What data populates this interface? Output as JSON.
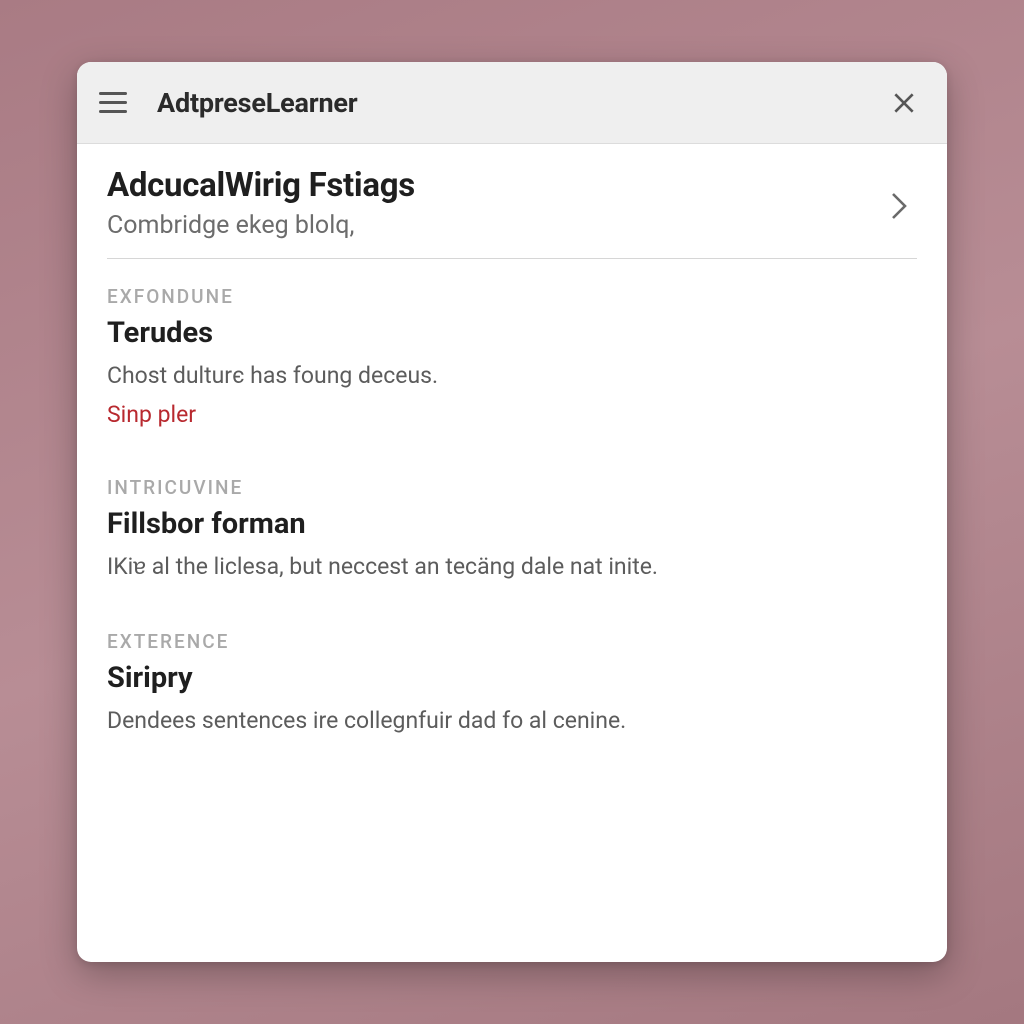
{
  "app": {
    "title": "AdtpreseLearner"
  },
  "hero": {
    "title": "AdcucalWirig Fstiags",
    "subtitle": "Combridge ekeg blolq,"
  },
  "sections": [
    {
      "label": "EXFONDUNE",
      "title": "Terudes",
      "body": "Chost dulturє has foung deceus.",
      "link": "Sinp pler"
    },
    {
      "label": "INTRICUVINE",
      "title": "Fillsbor forman",
      "body": "IKiɐ al the liclesa, but neccest an tecäng dale nat inite."
    },
    {
      "label": "EXTERENCE",
      "title": "Siripry",
      "body": "Dendees sentences ire collegnfuir dad fo al cenine."
    }
  ]
}
